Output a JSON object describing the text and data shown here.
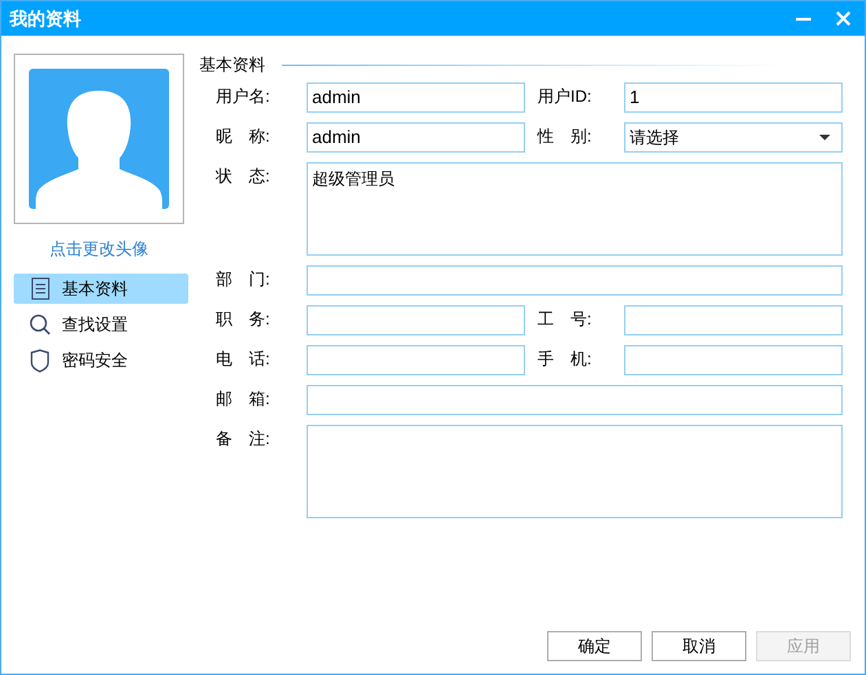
{
  "window": {
    "title": "我的资料"
  },
  "sidebar": {
    "avatar_link": "点击更改头像",
    "items": [
      {
        "label": "基本资料",
        "selected": true
      },
      {
        "label": "查找设置",
        "selected": false
      },
      {
        "label": "密码安全",
        "selected": false
      }
    ]
  },
  "section_title": "基本资料",
  "form_rows": [
    [
      {
        "label": "用户名:",
        "kind": "text",
        "value": "admin"
      },
      {
        "label": "用户ID:",
        "kind": "text",
        "value": "1"
      }
    ],
    [
      {
        "label": "昵　称:",
        "kind": "text",
        "value": "admin"
      },
      {
        "label": "性　别:",
        "kind": "select",
        "value": "请选择"
      }
    ],
    [
      {
        "label": "状　态:",
        "kind": "textarea",
        "value": "超级管理员"
      }
    ],
    [
      {
        "label": "部　门:",
        "kind": "text"
      }
    ],
    [
      {
        "label": "职　务:",
        "kind": "text"
      },
      {
        "label": "工　号:",
        "kind": "text"
      }
    ],
    [
      {
        "label": "电　话:",
        "kind": "text"
      },
      {
        "label": "手　机:",
        "kind": "text"
      }
    ],
    [
      {
        "label": "邮　箱:",
        "kind": "text"
      }
    ],
    [
      {
        "label": "备　注:",
        "kind": "textarea"
      }
    ]
  ],
  "buttons": [
    {
      "label": "确定",
      "disabled": false
    },
    {
      "label": "取消",
      "disabled": false
    },
    {
      "label": "应用",
      "disabled": true
    }
  ]
}
